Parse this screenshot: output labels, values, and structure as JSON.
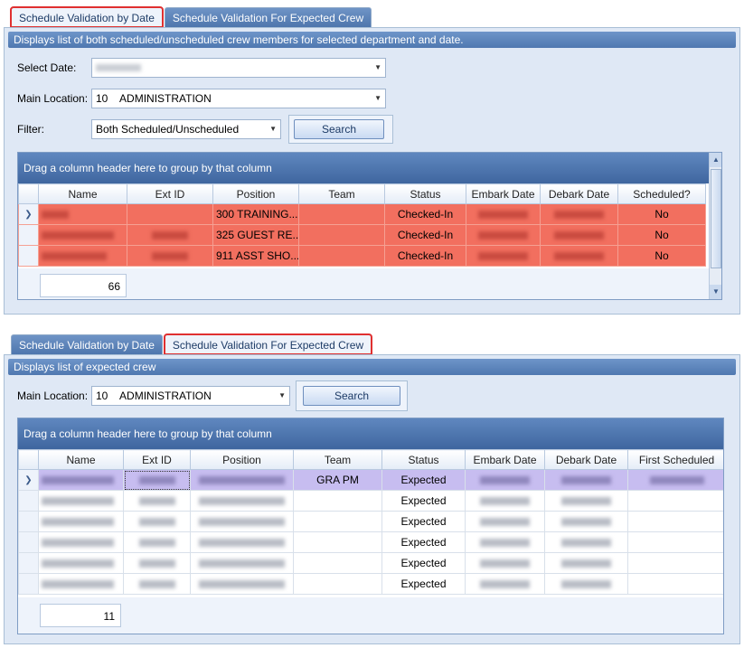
{
  "top": {
    "tabs": [
      "Schedule Validation by Date",
      "Schedule Validation For Expected Crew"
    ],
    "description": "Displays list of both scheduled/unscheduled crew members for selected department and date.",
    "select_date_label": "Select Date:",
    "main_location_label": "Main Location:",
    "main_location_value": "10    ADMINISTRATION",
    "filter_label": "Filter:",
    "filter_value": "Both Scheduled/Unscheduled",
    "search_label": "Search",
    "group_hint": "Drag a column header here to group by that column",
    "columns": [
      "Name",
      "Ext ID",
      "Position",
      "Team",
      "Status",
      "Embark Date",
      "Debark Date",
      "Scheduled?"
    ],
    "rows": [
      {
        "position": "300 TRAINING...",
        "status": "Checked-In",
        "scheduled": "No"
      },
      {
        "position": "325 GUEST RE...",
        "status": "Checked-In",
        "scheduled": "No"
      },
      {
        "position": "911 ASST SHO...",
        "status": "Checked-In",
        "scheduled": "No"
      }
    ],
    "count": "66",
    "row_color": "#f26f5f"
  },
  "bottom": {
    "tabs": [
      "Schedule Validation by Date",
      "Schedule Validation For Expected Crew"
    ],
    "description": "Displays list of expected crew",
    "main_location_label": "Main Location:",
    "main_location_value": "10    ADMINISTRATION",
    "search_label": "Search",
    "group_hint": "Drag a column header here to group by that column",
    "columns": [
      "Name",
      "Ext ID",
      "Position",
      "Team",
      "Status",
      "Embark Date",
      "Debark Date",
      "First Scheduled"
    ],
    "rows": [
      {
        "team": "GRA PM",
        "status": "Expected"
      },
      {
        "team": "",
        "status": "Expected"
      },
      {
        "team": "",
        "status": "Expected"
      },
      {
        "team": "",
        "status": "Expected"
      },
      {
        "team": "",
        "status": "Expected"
      },
      {
        "team": "",
        "status": "Expected"
      }
    ],
    "count": "11",
    "selected_row_color": "#c7bdf0"
  }
}
